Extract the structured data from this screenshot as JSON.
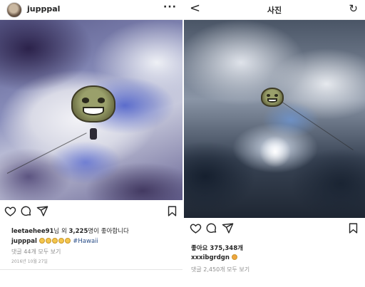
{
  "left_post": {
    "username": "jupppal",
    "more_label": "···",
    "likes_user": "leetaehee91",
    "likes_mid": "님 외 ",
    "likes_count": "3,225",
    "likes_suffix": "명이 좋아합니다",
    "caption_user": "jupppal",
    "caption_hashtag": "#Hawaii",
    "comments_text": "댓글 44개 모두 보기",
    "date_text": "2016년 10월 27일"
  },
  "right_post": {
    "nav_back": "<",
    "nav_title": "사진",
    "nav_refresh": "↻",
    "likes_text": "좋아요 375,348개",
    "caption_user": "xxxibgrdgn",
    "comments_text": "댓글 2,450개 모두 보기"
  },
  "icons": [
    "heart-icon",
    "comment-icon",
    "share-icon",
    "bookmark-icon",
    "back-icon",
    "refresh-icon",
    "more-icon"
  ],
  "colors": {
    "hashtag": "#2a4e88",
    "muted": "#8e8e8e",
    "text": "#262626"
  }
}
